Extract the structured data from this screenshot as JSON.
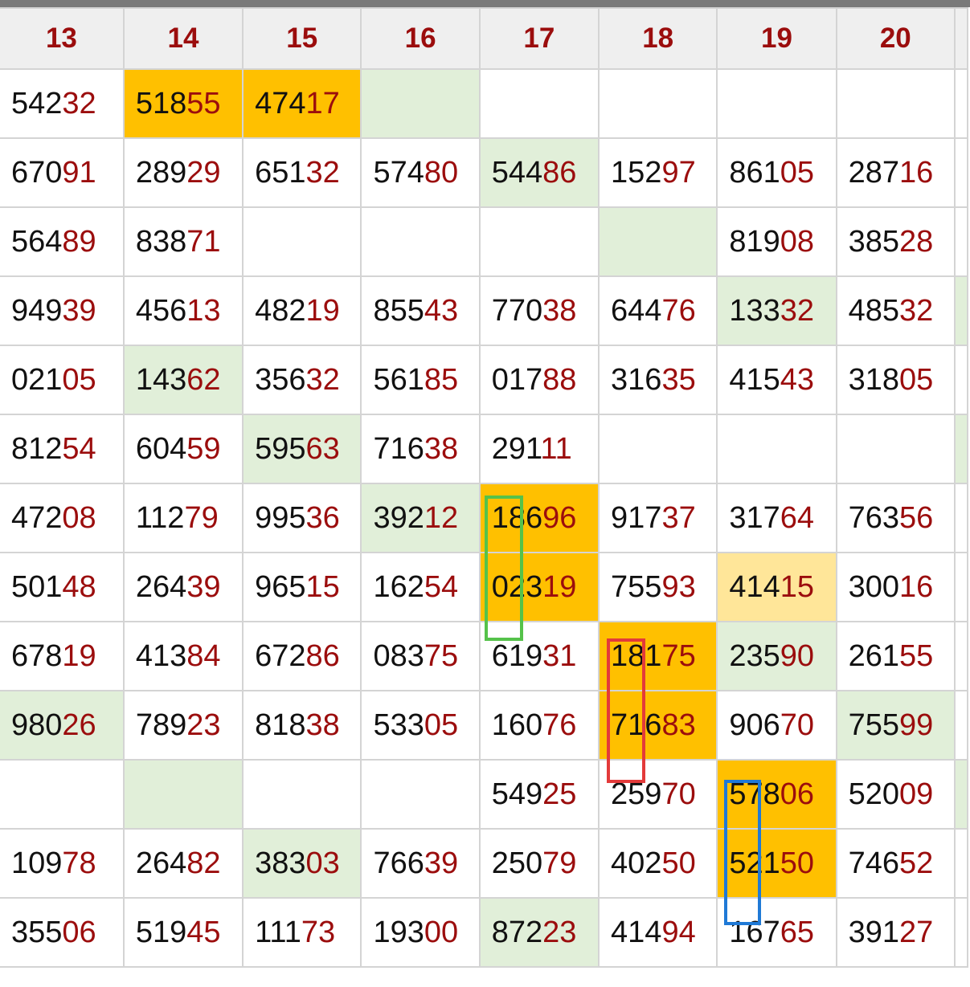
{
  "headers": [
    "13",
    "14",
    "15",
    "16",
    "17",
    "18",
    "19",
    "20"
  ],
  "rows": [
    [
      {
        "head": "542",
        "tail": "32",
        "bg": ""
      },
      {
        "head": "518",
        "tail": "55",
        "bg": "orange"
      },
      {
        "head": "474",
        "tail": "17",
        "bg": "orange"
      },
      {
        "head": "",
        "tail": "",
        "bg": "green"
      },
      {
        "head": "",
        "tail": "",
        "bg": ""
      },
      {
        "head": "",
        "tail": "",
        "bg": ""
      },
      {
        "head": "",
        "tail": "",
        "bg": ""
      },
      {
        "head": "",
        "tail": "",
        "bg": ""
      }
    ],
    [
      {
        "head": "670",
        "tail": "91",
        "bg": ""
      },
      {
        "head": "289",
        "tail": "29",
        "bg": ""
      },
      {
        "head": "651",
        "tail": "32",
        "bg": ""
      },
      {
        "head": "574",
        "tail": "80",
        "bg": ""
      },
      {
        "head": "544",
        "tail": "86",
        "bg": "green"
      },
      {
        "head": "152",
        "tail": "97",
        "bg": ""
      },
      {
        "head": "861",
        "tail": "05",
        "bg": ""
      },
      {
        "head": "287",
        "tail": "16",
        "bg": ""
      }
    ],
    [
      {
        "head": "564",
        "tail": "89",
        "bg": ""
      },
      {
        "head": "838",
        "tail": "71",
        "bg": ""
      },
      {
        "head": "",
        "tail": "",
        "bg": ""
      },
      {
        "head": "",
        "tail": "",
        "bg": ""
      },
      {
        "head": "",
        "tail": "",
        "bg": ""
      },
      {
        "head": "",
        "tail": "",
        "bg": "green"
      },
      {
        "head": "819",
        "tail": "08",
        "bg": ""
      },
      {
        "head": "385",
        "tail": "28",
        "bg": ""
      }
    ],
    [
      {
        "head": "949",
        "tail": "39",
        "bg": ""
      },
      {
        "head": "456",
        "tail": "13",
        "bg": ""
      },
      {
        "head": "482",
        "tail": "19",
        "bg": ""
      },
      {
        "head": "855",
        "tail": "43",
        "bg": ""
      },
      {
        "head": "770",
        "tail": "38",
        "bg": ""
      },
      {
        "head": "644",
        "tail": "76",
        "bg": ""
      },
      {
        "head": "133",
        "tail": "32",
        "bg": "green"
      },
      {
        "head": "485",
        "tail": "32",
        "bg": ""
      }
    ],
    [
      {
        "head": "021",
        "tail": "05",
        "bg": ""
      },
      {
        "head": "143",
        "tail": "62",
        "bg": "green"
      },
      {
        "head": "356",
        "tail": "32",
        "bg": ""
      },
      {
        "head": "561",
        "tail": "85",
        "bg": ""
      },
      {
        "head": "017",
        "tail": "88",
        "bg": ""
      },
      {
        "head": "316",
        "tail": "35",
        "bg": ""
      },
      {
        "head": "415",
        "tail": "43",
        "bg": ""
      },
      {
        "head": "318",
        "tail": "05",
        "bg": ""
      }
    ],
    [
      {
        "head": "812",
        "tail": "54",
        "bg": ""
      },
      {
        "head": "604",
        "tail": "59",
        "bg": ""
      },
      {
        "head": "595",
        "tail": "63",
        "bg": "green"
      },
      {
        "head": "716",
        "tail": "38",
        "bg": ""
      },
      {
        "head": "291",
        "tail": "11",
        "bg": ""
      },
      {
        "head": "",
        "tail": "",
        "bg": ""
      },
      {
        "head": "",
        "tail": "",
        "bg": ""
      },
      {
        "head": "",
        "tail": "",
        "bg": ""
      }
    ],
    [
      {
        "head": "472",
        "tail": "08",
        "bg": ""
      },
      {
        "head": "112",
        "tail": "79",
        "bg": ""
      },
      {
        "head": "995",
        "tail": "36",
        "bg": ""
      },
      {
        "head": "392",
        "tail": "12",
        "bg": "green"
      },
      {
        "head": "186",
        "tail": "96",
        "bg": "orange"
      },
      {
        "head": "917",
        "tail": "37",
        "bg": ""
      },
      {
        "head": "317",
        "tail": "64",
        "bg": ""
      },
      {
        "head": "763",
        "tail": "56",
        "bg": ""
      }
    ],
    [
      {
        "head": "501",
        "tail": "48",
        "bg": ""
      },
      {
        "head": "264",
        "tail": "39",
        "bg": ""
      },
      {
        "head": "965",
        "tail": "15",
        "bg": ""
      },
      {
        "head": "162",
        "tail": "54",
        "bg": ""
      },
      {
        "head": "023",
        "tail": "19",
        "bg": "orange"
      },
      {
        "head": "755",
        "tail": "93",
        "bg": ""
      },
      {
        "head": "414",
        "tail": "15",
        "bg": "lightorange"
      },
      {
        "head": "300",
        "tail": "16",
        "bg": ""
      }
    ],
    [
      {
        "head": "678",
        "tail": "19",
        "bg": ""
      },
      {
        "head": "413",
        "tail": "84",
        "bg": ""
      },
      {
        "head": "672",
        "tail": "86",
        "bg": ""
      },
      {
        "head": "083",
        "tail": "75",
        "bg": ""
      },
      {
        "head": "619",
        "tail": "31",
        "bg": ""
      },
      {
        "head": "181",
        "tail": "75",
        "bg": "orange"
      },
      {
        "head": "235",
        "tail": "90",
        "bg": "green"
      },
      {
        "head": "261",
        "tail": "55",
        "bg": ""
      }
    ],
    [
      {
        "head": "980",
        "tail": "26",
        "bg": "green"
      },
      {
        "head": "789",
        "tail": "23",
        "bg": ""
      },
      {
        "head": "818",
        "tail": "38",
        "bg": ""
      },
      {
        "head": "533",
        "tail": "05",
        "bg": ""
      },
      {
        "head": "160",
        "tail": "76",
        "bg": ""
      },
      {
        "head": "716",
        "tail": "83",
        "bg": "orange"
      },
      {
        "head": "906",
        "tail": "70",
        "bg": ""
      },
      {
        "head": "755",
        "tail": "99",
        "bg": "green"
      }
    ],
    [
      {
        "head": "",
        "tail": "",
        "bg": ""
      },
      {
        "head": "",
        "tail": "",
        "bg": "green"
      },
      {
        "head": "",
        "tail": "",
        "bg": ""
      },
      {
        "head": "",
        "tail": "",
        "bg": ""
      },
      {
        "head": "549",
        "tail": "25",
        "bg": ""
      },
      {
        "head": "259",
        "tail": "70",
        "bg": ""
      },
      {
        "head": "578",
        "tail": "06",
        "bg": "orange"
      },
      {
        "head": "520",
        "tail": "09",
        "bg": ""
      }
    ],
    [
      {
        "head": "109",
        "tail": "78",
        "bg": ""
      },
      {
        "head": "264",
        "tail": "82",
        "bg": ""
      },
      {
        "head": "383",
        "tail": "03",
        "bg": "green"
      },
      {
        "head": "766",
        "tail": "39",
        "bg": ""
      },
      {
        "head": "250",
        "tail": "79",
        "bg": ""
      },
      {
        "head": "402",
        "tail": "50",
        "bg": ""
      },
      {
        "head": "521",
        "tail": "50",
        "bg": "orange"
      },
      {
        "head": "746",
        "tail": "52",
        "bg": ""
      }
    ],
    [
      {
        "head": "355",
        "tail": "06",
        "bg": ""
      },
      {
        "head": "519",
        "tail": "45",
        "bg": ""
      },
      {
        "head": "111",
        "tail": "73",
        "bg": ""
      },
      {
        "head": "193",
        "tail": "00",
        "bg": ""
      },
      {
        "head": "872",
        "tail": "23",
        "bg": "green"
      },
      {
        "head": "414",
        "tail": "94",
        "bg": ""
      },
      {
        "head": "167",
        "tail": "65",
        "bg": ""
      },
      {
        "head": "391",
        "tail": "27",
        "bg": ""
      }
    ]
  ],
  "stub_column_bg": [
    "",
    "",
    "",
    "green",
    "",
    "green",
    "",
    "",
    "",
    "",
    "green",
    "",
    ""
  ],
  "colors": {
    "header_text": "#9b0d0d",
    "tail_text": "#9b0d0d",
    "highlight_orange": "#ffc000",
    "highlight_light_orange": "#ffe699",
    "highlight_green": "#e1efd9",
    "marker_green": "#55c24a",
    "marker_red": "#e33a3a",
    "marker_blue": "#1f79d6"
  }
}
